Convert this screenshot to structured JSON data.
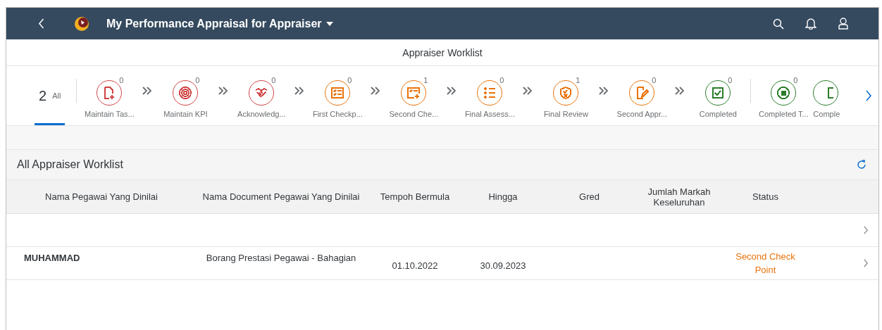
{
  "shell": {
    "title": "My Performance Appraisal for Appraiser"
  },
  "page_title": "Appraiser Worklist",
  "all_tab": {
    "count": "2",
    "label": "All",
    "selected": true
  },
  "stages": [
    {
      "label": "Maintain Tas...",
      "count": "0",
      "kind": "document-plus",
      "color": "#d04343",
      "arrow_after": true,
      "divider_after": false
    },
    {
      "label": "Maintain KPI",
      "count": "0",
      "kind": "target",
      "color": "#d04343",
      "arrow_after": true,
      "divider_after": false
    },
    {
      "label": "Acknowledg...",
      "count": "0",
      "kind": "handshake",
      "color": "#d04343",
      "arrow_after": true,
      "divider_after": false
    },
    {
      "label": "First Checkp...",
      "count": "0",
      "kind": "checklist",
      "color": "#e9730c",
      "arrow_after": true,
      "divider_after": false
    },
    {
      "label": "Second Che...",
      "count": "1",
      "kind": "checklist-plus",
      "color": "#e9730c",
      "arrow_after": true,
      "divider_after": false
    },
    {
      "label": "Final Assess...",
      "count": "0",
      "kind": "bullet-list",
      "color": "#e9730c",
      "arrow_after": true,
      "divider_after": false
    },
    {
      "label": "Final Review",
      "count": "1",
      "kind": "shield",
      "color": "#e9730c",
      "arrow_after": true,
      "divider_after": false
    },
    {
      "label": "Second Appr...",
      "count": "0",
      "kind": "document-pen",
      "color": "#e9730c",
      "arrow_after": true,
      "divider_after": false
    },
    {
      "label": "Completed",
      "count": "0",
      "kind": "checkbox",
      "color": "#2b7d2b",
      "arrow_after": false,
      "divider_after": true
    },
    {
      "label": "Completed T...",
      "count": "0",
      "kind": "stop",
      "color": "#2b7d2b",
      "arrow_after": false,
      "divider_after": false
    },
    {
      "label": "Comple",
      "kind": "document",
      "color": "#2b7d2b",
      "arrow_after": false,
      "divider_after": false
    }
  ],
  "table": {
    "title": "All Appraiser Worklist",
    "columns": [
      "Nama Pegawai Yang Dinilai",
      "Nama Document Pegawai Yang Dinilai",
      "Tempoh Bermula",
      "Hingga",
      "Gred",
      "Jumlah Markah Keseluruhan",
      "Status"
    ],
    "rows": [
      {
        "navigable": true
      },
      {
        "employee": "MUHAMMAD",
        "document": "Borang Prestasi Pegawai - Bahagian",
        "start": "01.10.2022",
        "end": "30.09.2023",
        "status": "Second Check Point",
        "navigable": true
      }
    ]
  }
}
